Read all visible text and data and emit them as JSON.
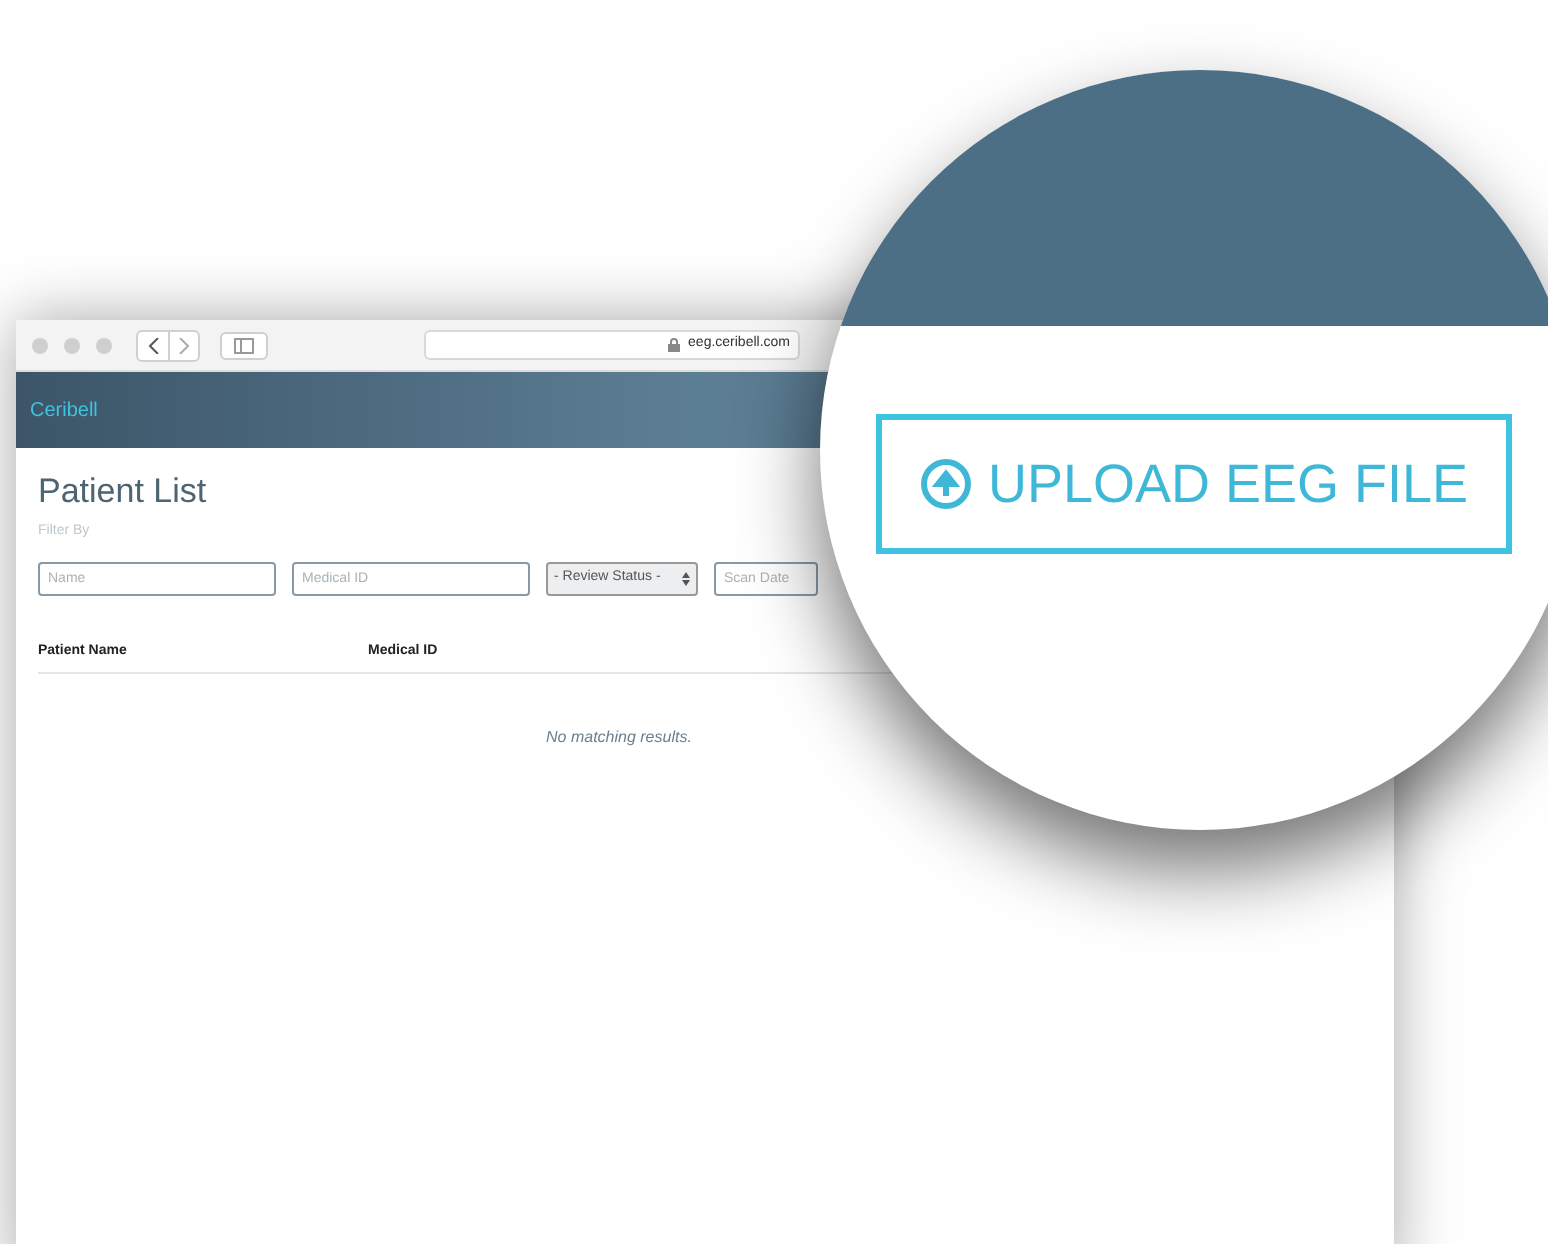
{
  "browser": {
    "url": "eeg.ceribell.com"
  },
  "header": {
    "brand": "Ceribell"
  },
  "page": {
    "title": "Patient List",
    "filter_label": "Filter By"
  },
  "filters": [
    {
      "kind": "text",
      "placeholder": "Name"
    },
    {
      "kind": "text",
      "placeholder": "Medical ID"
    },
    {
      "kind": "select",
      "value": "- Review Status -"
    },
    {
      "kind": "text",
      "placeholder": "Scan Date"
    }
  ],
  "table": {
    "columns": [
      "Patient Name",
      "Medical ID"
    ],
    "empty_message": "No matching results."
  },
  "magnifier": {
    "button": "UPLOAD EEG FILE"
  }
}
